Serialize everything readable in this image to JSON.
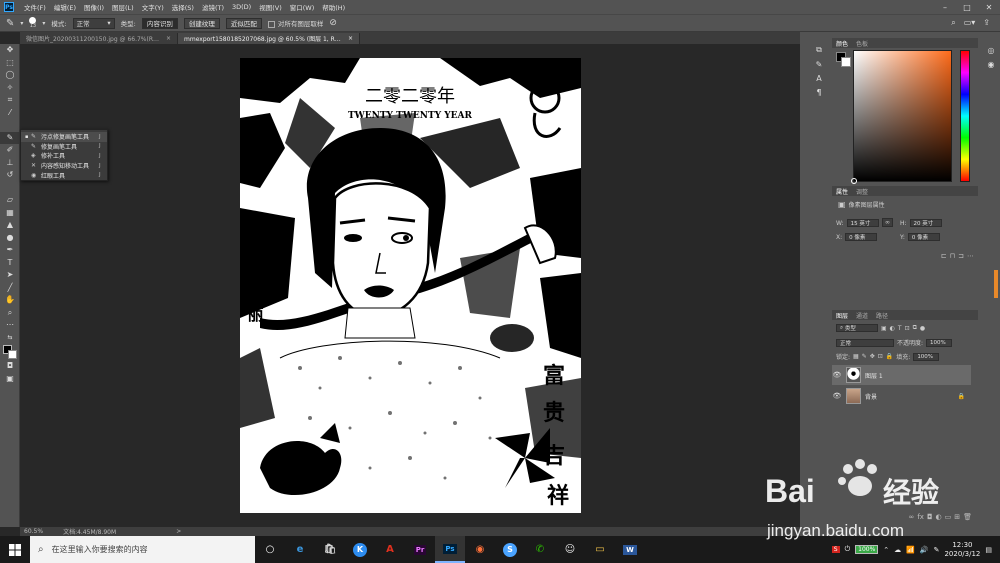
{
  "menubar": {
    "logo": "Ps",
    "items": [
      "文件(F)",
      "编辑(E)",
      "图像(I)",
      "图层(L)",
      "文字(Y)",
      "选择(S)",
      "滤镜(T)",
      "3D(D)",
      "视图(V)",
      "窗口(W)",
      "帮助(H)"
    ],
    "controls": {
      "minimize": "–",
      "maximize": "□",
      "close": "✕"
    }
  },
  "options": {
    "brush_size": "13",
    "mode_label": "模式:",
    "mode_value": "正常",
    "type_label": "类型:",
    "type_buttons": [
      "内容识别",
      "创建纹理",
      "近似匹配"
    ],
    "sample_all_label": "对所有图层取样"
  },
  "tabs": [
    {
      "label": "微信图片_20200311200150.jpg @ 66.7%(RGB/8)",
      "close": "×"
    },
    {
      "label": "mmexport1580185207068.jpg @ 60.5% (图层 1, RGB/8#) *",
      "close": "×"
    }
  ],
  "toolbar": {
    "icons": [
      "move",
      "marquee",
      "lasso",
      "magic-wand",
      "crop",
      "eyedropper",
      "spot-healing",
      "brush",
      "stamp",
      "history-brush",
      "eraser",
      "gradient",
      "blur",
      "dodge",
      "pen",
      "type",
      "path-select",
      "rectangle",
      "hand",
      "zoom",
      "more"
    ]
  },
  "flyout": [
    {
      "label": "污点修复画笔工具",
      "key": "J",
      "selected": true
    },
    {
      "label": "修复画笔工具",
      "key": "J",
      "selected": false
    },
    {
      "label": "修补工具",
      "key": "J",
      "selected": false
    },
    {
      "label": "内容感知移动工具",
      "key": "J",
      "selected": false
    },
    {
      "label": "红眼工具",
      "key": "J",
      "selected": false
    }
  ],
  "artwork": {
    "title_cn": "二零二零年",
    "title_en": "TWENTY TWENTY YEAR",
    "left_chars": "美丽",
    "right_chars": [
      "富",
      "贵",
      "吉",
      "祥"
    ]
  },
  "status": {
    "zoom": "60.5%",
    "doc": "文档:4.45M/8.90M",
    "arrow": ">"
  },
  "color_panel": {
    "tabs": [
      "颜色",
      "色板"
    ],
    "hue_color": "#ff6b1a"
  },
  "properties": {
    "tabs": [
      "属性",
      "调整"
    ],
    "title": "像素图层属性",
    "w_label": "W:",
    "w_value": "15 英寸",
    "h_label": "H:",
    "h_value": "20 英寸",
    "x_label": "X:",
    "x_value": "0 像素",
    "y_label": "Y:",
    "y_value": "0 像素"
  },
  "layers": {
    "tabs": [
      "图层",
      "通道",
      "路径"
    ],
    "filter_value": "类型",
    "blend_value": "正常",
    "opacity_label": "不透明度:",
    "opacity_value": "100%",
    "lock_label": "锁定:",
    "fill_label": "填充:",
    "fill_value": "100%",
    "items": [
      {
        "name": "图层 1",
        "selected": true
      },
      {
        "name": "背景",
        "selected": false
      }
    ]
  },
  "taskbar": {
    "search_placeholder": "在这里输入你要搜索的内容",
    "battery": "100%",
    "time": "12:30",
    "date": "2020/3/12",
    "apps": [
      {
        "name": "edge",
        "glyph": "e",
        "color": "#3a96dd"
      },
      {
        "name": "store",
        "glyph": "🛍",
        "color": "#f3f3f3"
      },
      {
        "name": "kugou",
        "glyph": "K",
        "color": "#2d8cf0"
      },
      {
        "name": "acrobat",
        "glyph": "A",
        "color": "#e0301e"
      },
      {
        "name": "premiere",
        "glyph": "Pr",
        "color": "#ea77ff"
      },
      {
        "name": "photoshop",
        "glyph": "Ps",
        "color": "#31a8ff"
      },
      {
        "name": "firefox",
        "glyph": "◉",
        "color": "#ff7139"
      },
      {
        "name": "sogou",
        "glyph": "S",
        "color": "#4aa3ff"
      },
      {
        "name": "wechat",
        "glyph": "✆",
        "color": "#2dc100"
      },
      {
        "name": "qq",
        "glyph": "☺",
        "color": "#eee"
      },
      {
        "name": "explorer",
        "glyph": "▭",
        "color": "#f2c34a"
      },
      {
        "name": "word",
        "glyph": "W",
        "color": "#2b579a"
      }
    ]
  },
  "watermark": {
    "brand": "Bai",
    "brand2": "经验",
    "url": "jingyan.baidu.com"
  }
}
